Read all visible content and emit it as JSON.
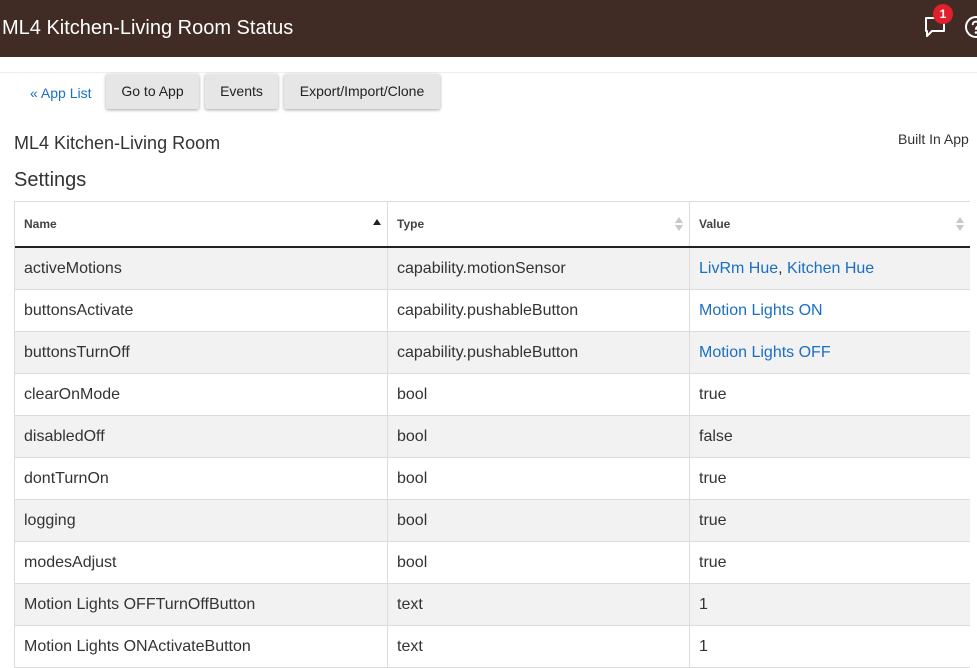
{
  "header": {
    "title": "ML4 Kitchen-Living Room Status",
    "notification_count": "1"
  },
  "nav": {
    "app_list_label": "« App List",
    "buttons": [
      "Go to App",
      "Events",
      "Export/Import/Clone"
    ]
  },
  "app": {
    "name": "ML4 Kitchen-Living Room",
    "built_in_label": "Built In App"
  },
  "settings": {
    "title": "Settings",
    "columns": [
      "Name",
      "Type",
      "Value"
    ],
    "rows": [
      {
        "name": "activeMotions",
        "type": "capability.motionSensor",
        "values": [
          "LivRm Hue",
          "Kitchen Hue"
        ],
        "link": true
      },
      {
        "name": "buttonsActivate",
        "type": "capability.pushableButton",
        "values": [
          "Motion Lights ON"
        ],
        "link": true
      },
      {
        "name": "buttonsTurnOff",
        "type": "capability.pushableButton",
        "values": [
          "Motion Lights OFF"
        ],
        "link": true
      },
      {
        "name": "clearOnMode",
        "type": "bool",
        "values": [
          "true"
        ],
        "link": false
      },
      {
        "name": "disabledOff",
        "type": "bool",
        "values": [
          "false"
        ],
        "link": false
      },
      {
        "name": "dontTurnOn",
        "type": "bool",
        "values": [
          "true"
        ],
        "link": false
      },
      {
        "name": "logging",
        "type": "bool",
        "values": [
          "true"
        ],
        "link": false
      },
      {
        "name": "modesAdjust",
        "type": "bool",
        "values": [
          "true"
        ],
        "link": false
      },
      {
        "name": "Motion Lights OFFTurnOffButton",
        "type": "text",
        "values": [
          "1"
        ],
        "link": false
      },
      {
        "name": "Motion Lights ONActivateButton",
        "type": "text",
        "values": [
          "1"
        ],
        "link": false
      }
    ]
  },
  "colors": {
    "header_bg": "#402b25",
    "link": "#1a6fc4",
    "badge": "#e0202c"
  }
}
